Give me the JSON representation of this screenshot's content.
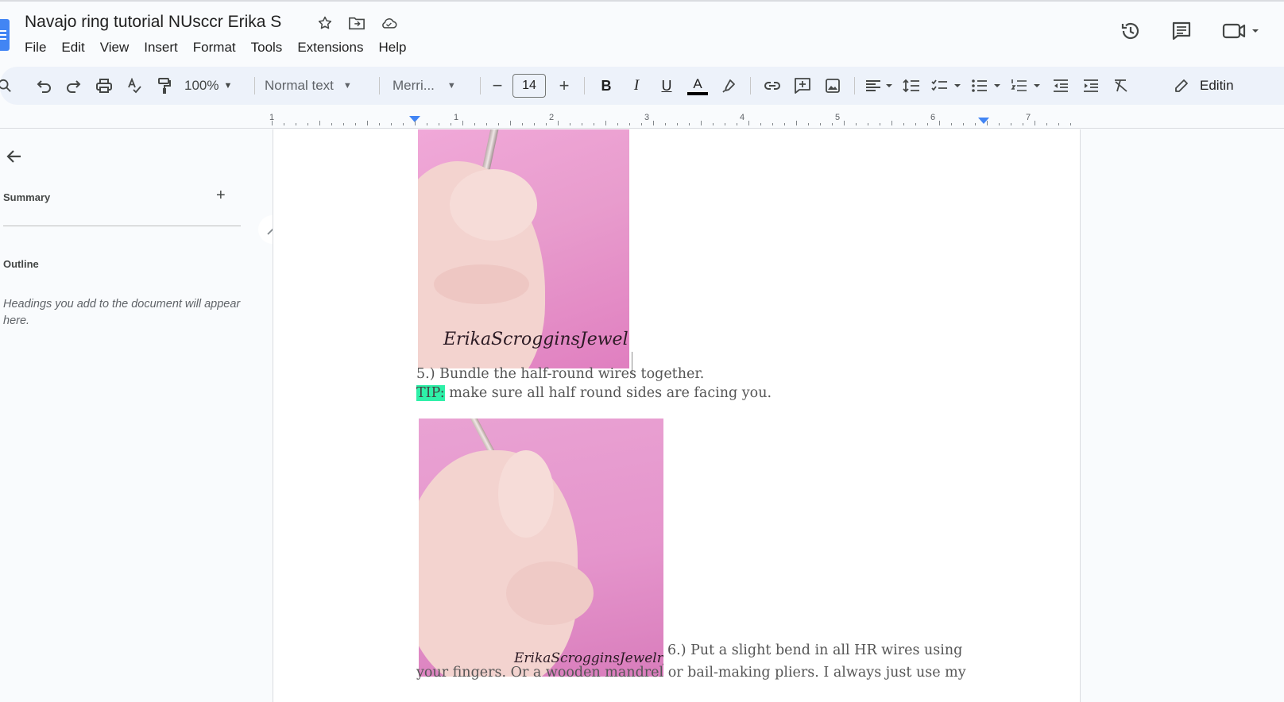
{
  "doc": {
    "title": "Navajo ring tutorial NUsccr Erika S"
  },
  "menu": [
    "File",
    "Edit",
    "View",
    "Insert",
    "Format",
    "Tools",
    "Extensions",
    "Help"
  ],
  "toolbar": {
    "zoom": "100%",
    "style": "Normal text",
    "font": "Merri...",
    "font_size": "14",
    "bold": "B",
    "italic": "I",
    "underline": "U",
    "text_color": "A",
    "editing": "Editin"
  },
  "ruler": {
    "labels": [
      "1",
      "1",
      "2",
      "3",
      "4",
      "5",
      "6",
      "7"
    ]
  },
  "sidebar": {
    "summary": "Summary",
    "add": "+",
    "outline": "Outline",
    "hint": "Headings you add to the document will appear here."
  },
  "content": {
    "watermark1": "ErikaScrogginsJewelry",
    "watermark2": "ErikaScrogginsJewelry",
    "step5": "5.) Bundle the half-round wires together.",
    "tip_label": "TIP:",
    "tip_text": " make sure all half round sides are facing you.",
    "step6_line1": "6.) Put a slight bend in all HR wires using",
    "step6_line2": "your fingers. Or a wooden mandrel or bail-making pliers. I always just use my"
  },
  "colors": {
    "accent": "#4285f4",
    "toolbar_bg": "#edf2fa",
    "highlight": "#2ef0a8",
    "photo_pink": "#e89ccd"
  },
  "icons": {
    "title": [
      "star-icon",
      "move-to-folder-icon",
      "cloud-saved-icon"
    ],
    "right": [
      "version-history-icon",
      "comments-icon",
      "meet-camera-icon"
    ]
  }
}
